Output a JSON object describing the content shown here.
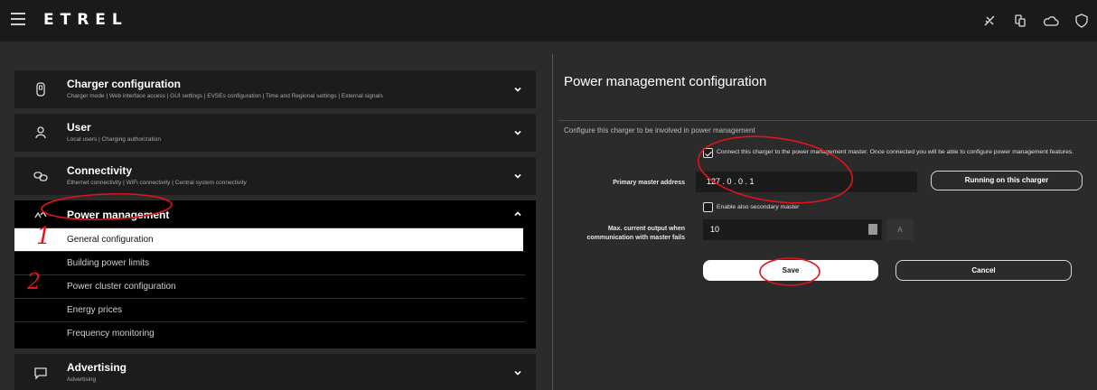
{
  "brand": {
    "logo": "ETREL"
  },
  "topbar_icons": [
    "signal-off-icon",
    "devices-icon",
    "cloud-icon",
    "shield-icon"
  ],
  "sidebar": {
    "sections": [
      {
        "title": "Charger configuration",
        "subtitle": "Charger mode  |  Web interface access  |  GUI settings  |  EVSEs configuration  |  Time and Regional settings  |  External signals",
        "icon": "charger-icon"
      },
      {
        "title": "User",
        "subtitle": "Local users  |  Charging authorization",
        "icon": "user-icon"
      },
      {
        "title": "Connectivity",
        "subtitle": "Ethernet connectivity  |  WiFi connectivity  |  Central system connectivity",
        "icon": "link-icon"
      }
    ],
    "power_management": {
      "title": "Power management",
      "icon": "power-arrows-icon",
      "items": [
        "General configuration",
        "Building power limits",
        "Power cluster configuration",
        "Energy prices",
        "Frequency monitoring"
      ],
      "active_index": 0
    },
    "advertising": {
      "title": "Advertising",
      "subtitle": "Advertising",
      "icon": "message-icon"
    }
  },
  "panel": {
    "title": "Power management configuration",
    "description": "Configure this charger to be involved in power management",
    "connect_checkbox": {
      "checked": true,
      "label": "Connect this charger to the power management master. Once connected you will be able to configure power management features."
    },
    "primary_address": {
      "label": "Primary master address",
      "value": "127 . 0 . 0 . 1"
    },
    "running_button": "Running on this charger",
    "secondary_checkbox": {
      "checked": false,
      "label": "Enable also secondary master"
    },
    "max_current": {
      "label": "Max. current output when communication with master fails",
      "value": "10",
      "unit": "A"
    },
    "save_button": "Save",
    "cancel_button": "Cancel"
  },
  "annotations": {
    "mark_1": "1",
    "mark_2": "2"
  },
  "colors": {
    "annotation": "#e0141b",
    "topbar": "#1a1a1a",
    "background": "#2b2b2b"
  }
}
